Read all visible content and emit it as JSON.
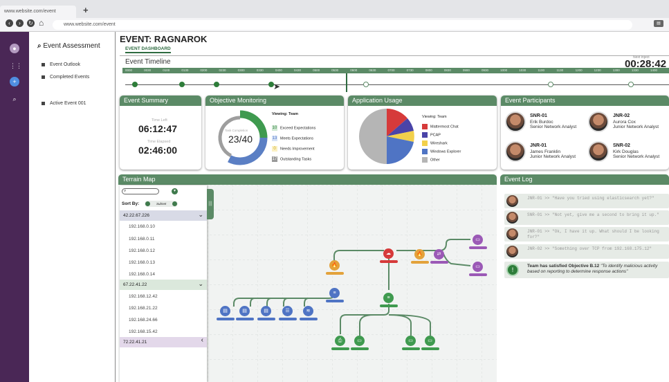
{
  "browser": {
    "tab_title": "www.website.com/event",
    "new_tab": "+",
    "url": "www.website.com/event",
    "ext_label": "▤"
  },
  "nav": {
    "title": "Event Assessment",
    "items": [
      "Event Outlook",
      "Completed Events",
      "Active Event 001"
    ]
  },
  "header": {
    "event_title": "EVENT: RAGNAROK",
    "tab_label": "EVENT DASHBOARD"
  },
  "timeline": {
    "title": "Event Timeline",
    "clock_label": "Next Inject",
    "clock": "00:28:42",
    "ticks": [
      "0000",
      "0030",
      "0100",
      "0130",
      "0200",
      "0230",
      "0300",
      "0330",
      "0400",
      "0430",
      "0500",
      "0530",
      "0600",
      "0630",
      "0700",
      "0730",
      "0800",
      "0830",
      "0900",
      "0930",
      "1000",
      "1030",
      "1100",
      "1130",
      "1200",
      "1230",
      "1300",
      "1330",
      "1400"
    ]
  },
  "summary": {
    "title": "Event Summary",
    "left_label": "Time Left",
    "left_value": "06:12:47",
    "elapsed_label": "Time Elapsed",
    "elapsed_value": "02:46:00"
  },
  "objectives": {
    "title": "Objective Monitoring",
    "donut_label": "Task Completion",
    "donut_value": "23/40",
    "viewing": "Viewing: Team",
    "rows": [
      {
        "count": "10",
        "label": "Exceed Expectations",
        "color": "#3f9a4f"
      },
      {
        "count": "13",
        "label": "Meets Expectations",
        "color": "#5b7fc4"
      },
      {
        "count": "0",
        "label": "Needs Improvement",
        "color": "#f2d04b"
      },
      {
        "count": "17",
        "label": "Outstanding Tasks",
        "color": "#999999"
      }
    ],
    "progress": {
      "exceed": 10,
      "meets": 13,
      "needs": 0,
      "outstanding": 17
    }
  },
  "apps": {
    "title": "Application Usage",
    "viewing": "Viewing: Team",
    "legend": [
      {
        "label": "Mattermost Chat",
        "color": "#d63a3a"
      },
      {
        "label": "PCAP",
        "color": "#4a44a8"
      },
      {
        "label": "Wireshark",
        "color": "#f2d04b"
      },
      {
        "label": "Windows Explorer",
        "color": "#4f74c4"
      },
      {
        "label": "Other",
        "color": "#b5b5b5"
      }
    ]
  },
  "participants": {
    "title": "Event Participants",
    "people": [
      {
        "code": "SNR-01",
        "name": "Erik Burdoc",
        "role": "Senior Network Analyst"
      },
      {
        "code": "JNR-02",
        "name": "Aurora Cox",
        "role": "Junior  Network Analyst"
      },
      {
        "code": "JNR-01",
        "name": "James Franklin",
        "role": "Junior Network Analyst"
      },
      {
        "code": "SNR-02",
        "name": "Kirk Douglas",
        "role": "Senior Network Analyst"
      }
    ]
  },
  "terrain": {
    "title": "Terrain Map",
    "sort_label": "Sort By:",
    "sort_value": "Subnet",
    "subnets": [
      {
        "name": "42.22.67.226",
        "hosts": [
          "192.168.0.10",
          "192.168.0.11",
          "192.168.0.12",
          "192.168.0.13",
          "192.168.0.14"
        ]
      },
      {
        "name": "67.22.41.22",
        "hosts": [
          "192.168.12.42",
          "192.168.21.22",
          "192.168.24.66",
          "192.168.15.42"
        ]
      },
      {
        "name": "72.22.41.21",
        "hosts": []
      }
    ]
  },
  "log": {
    "title": "Event Log",
    "entries": [
      "JNR-01 >> \"Have you tried using elasticsearch yet?\"",
      "SNR-01 >> \"Not yet, give me a second to bring it up.\"",
      "JNR-01 >> \"Ok, I have it up.  What should I be looking for?\"",
      "JNR-02 >> \"Something over TCP from 192.168.175.12\""
    ],
    "final_bold": "Team has satisfied Objective B.12 ",
    "final_italic": "\"To identify malicious activity based on reporting to determine response actions\""
  }
}
